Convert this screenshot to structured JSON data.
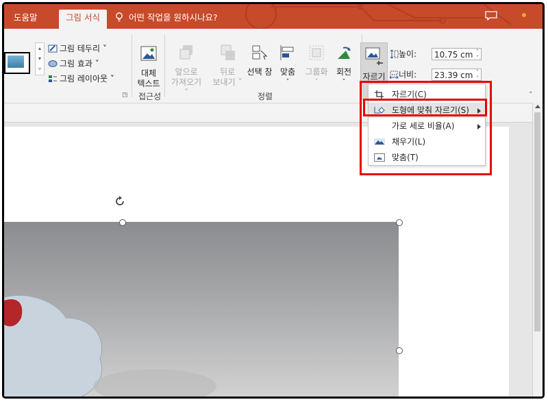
{
  "tabs": {
    "help": "도움말",
    "picture_format": "그림 서식"
  },
  "tell_me": "어떤 작업을 원하시나요?",
  "ribbon": {
    "picture_styles": {
      "border": "그림 테두리",
      "effects": "그림 효과",
      "layout": "그림 레이아웃"
    },
    "accessibility": {
      "alt_text_line1": "대체",
      "alt_text_line2": "텍스트",
      "group_label": "접근성"
    },
    "arrange": {
      "bring_forward_line1": "앞으로",
      "bring_forward_line2": "가져오기",
      "send_backward_line1": "뒤로",
      "send_backward_line2": "보내기",
      "selection_pane": "선택 창",
      "align": "맞춤",
      "group": "그룹화",
      "rotate": "회전",
      "group_label": "정렬"
    },
    "size": {
      "crop": "자르기",
      "height_label": "높이:",
      "height_value": "10.75 cm",
      "width_label": "너비:",
      "width_value": "23.39 cm"
    }
  },
  "crop_menu": {
    "items": [
      {
        "label": "자르기(C)",
        "icon": "crop-icon",
        "submenu": false
      },
      {
        "label": "도형에 맞춰 자르기(S)",
        "icon": "crop-to-shape-icon",
        "submenu": true
      },
      {
        "label": "가로 세로 비율(A)",
        "icon": "",
        "submenu": true
      },
      {
        "label": "채우기(L)",
        "icon": "fill-icon",
        "submenu": false
      },
      {
        "label": "맞춤(T)",
        "icon": "fit-icon",
        "submenu": false
      }
    ]
  },
  "colors": {
    "accent": "#c74a2b",
    "highlight": "#e60000"
  }
}
